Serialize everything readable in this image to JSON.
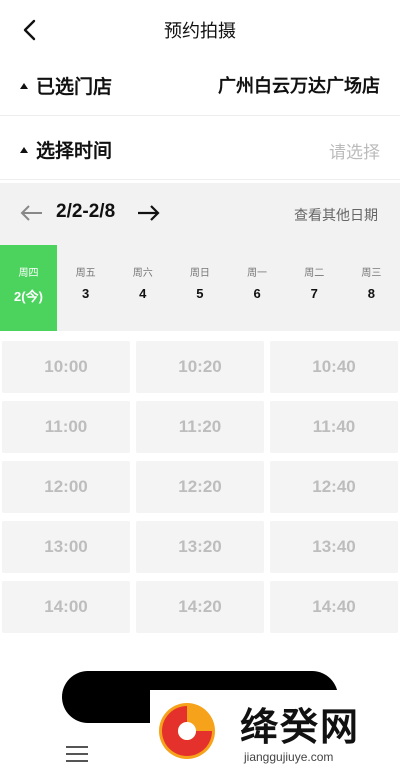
{
  "header": {
    "title": "预约拍摄"
  },
  "store_row": {
    "label": "已选门店",
    "value": "广州白云万达广场店"
  },
  "time_row": {
    "label": "选择时间",
    "placeholder": "请选择"
  },
  "week": {
    "range": "2/2-2/8",
    "other_dates": "查看其他日期",
    "days": [
      {
        "weekday": "周四",
        "date": "2(今)",
        "selected": true
      },
      {
        "weekday": "周五",
        "date": "3"
      },
      {
        "weekday": "周六",
        "date": "4"
      },
      {
        "weekday": "周日",
        "date": "5"
      },
      {
        "weekday": "周一",
        "date": "6"
      },
      {
        "weekday": "周二",
        "date": "7"
      },
      {
        "weekday": "周三",
        "date": "8"
      }
    ]
  },
  "slots": [
    [
      "10:00",
      "10:20",
      "10:40"
    ],
    [
      "11:00",
      "11:20",
      "11:40"
    ],
    [
      "12:00",
      "12:20",
      "12:40"
    ],
    [
      "13:00",
      "13:20",
      "13:40"
    ],
    [
      "14:00",
      "14:20",
      "14:40"
    ]
  ],
  "colors": {
    "accent": "#4cd35e",
    "slot_bg": "#f4f4f4",
    "slot_text": "#bdbdbd"
  },
  "watermark": {
    "text": "绛癸网",
    "url": "jianggujiuye.com"
  }
}
